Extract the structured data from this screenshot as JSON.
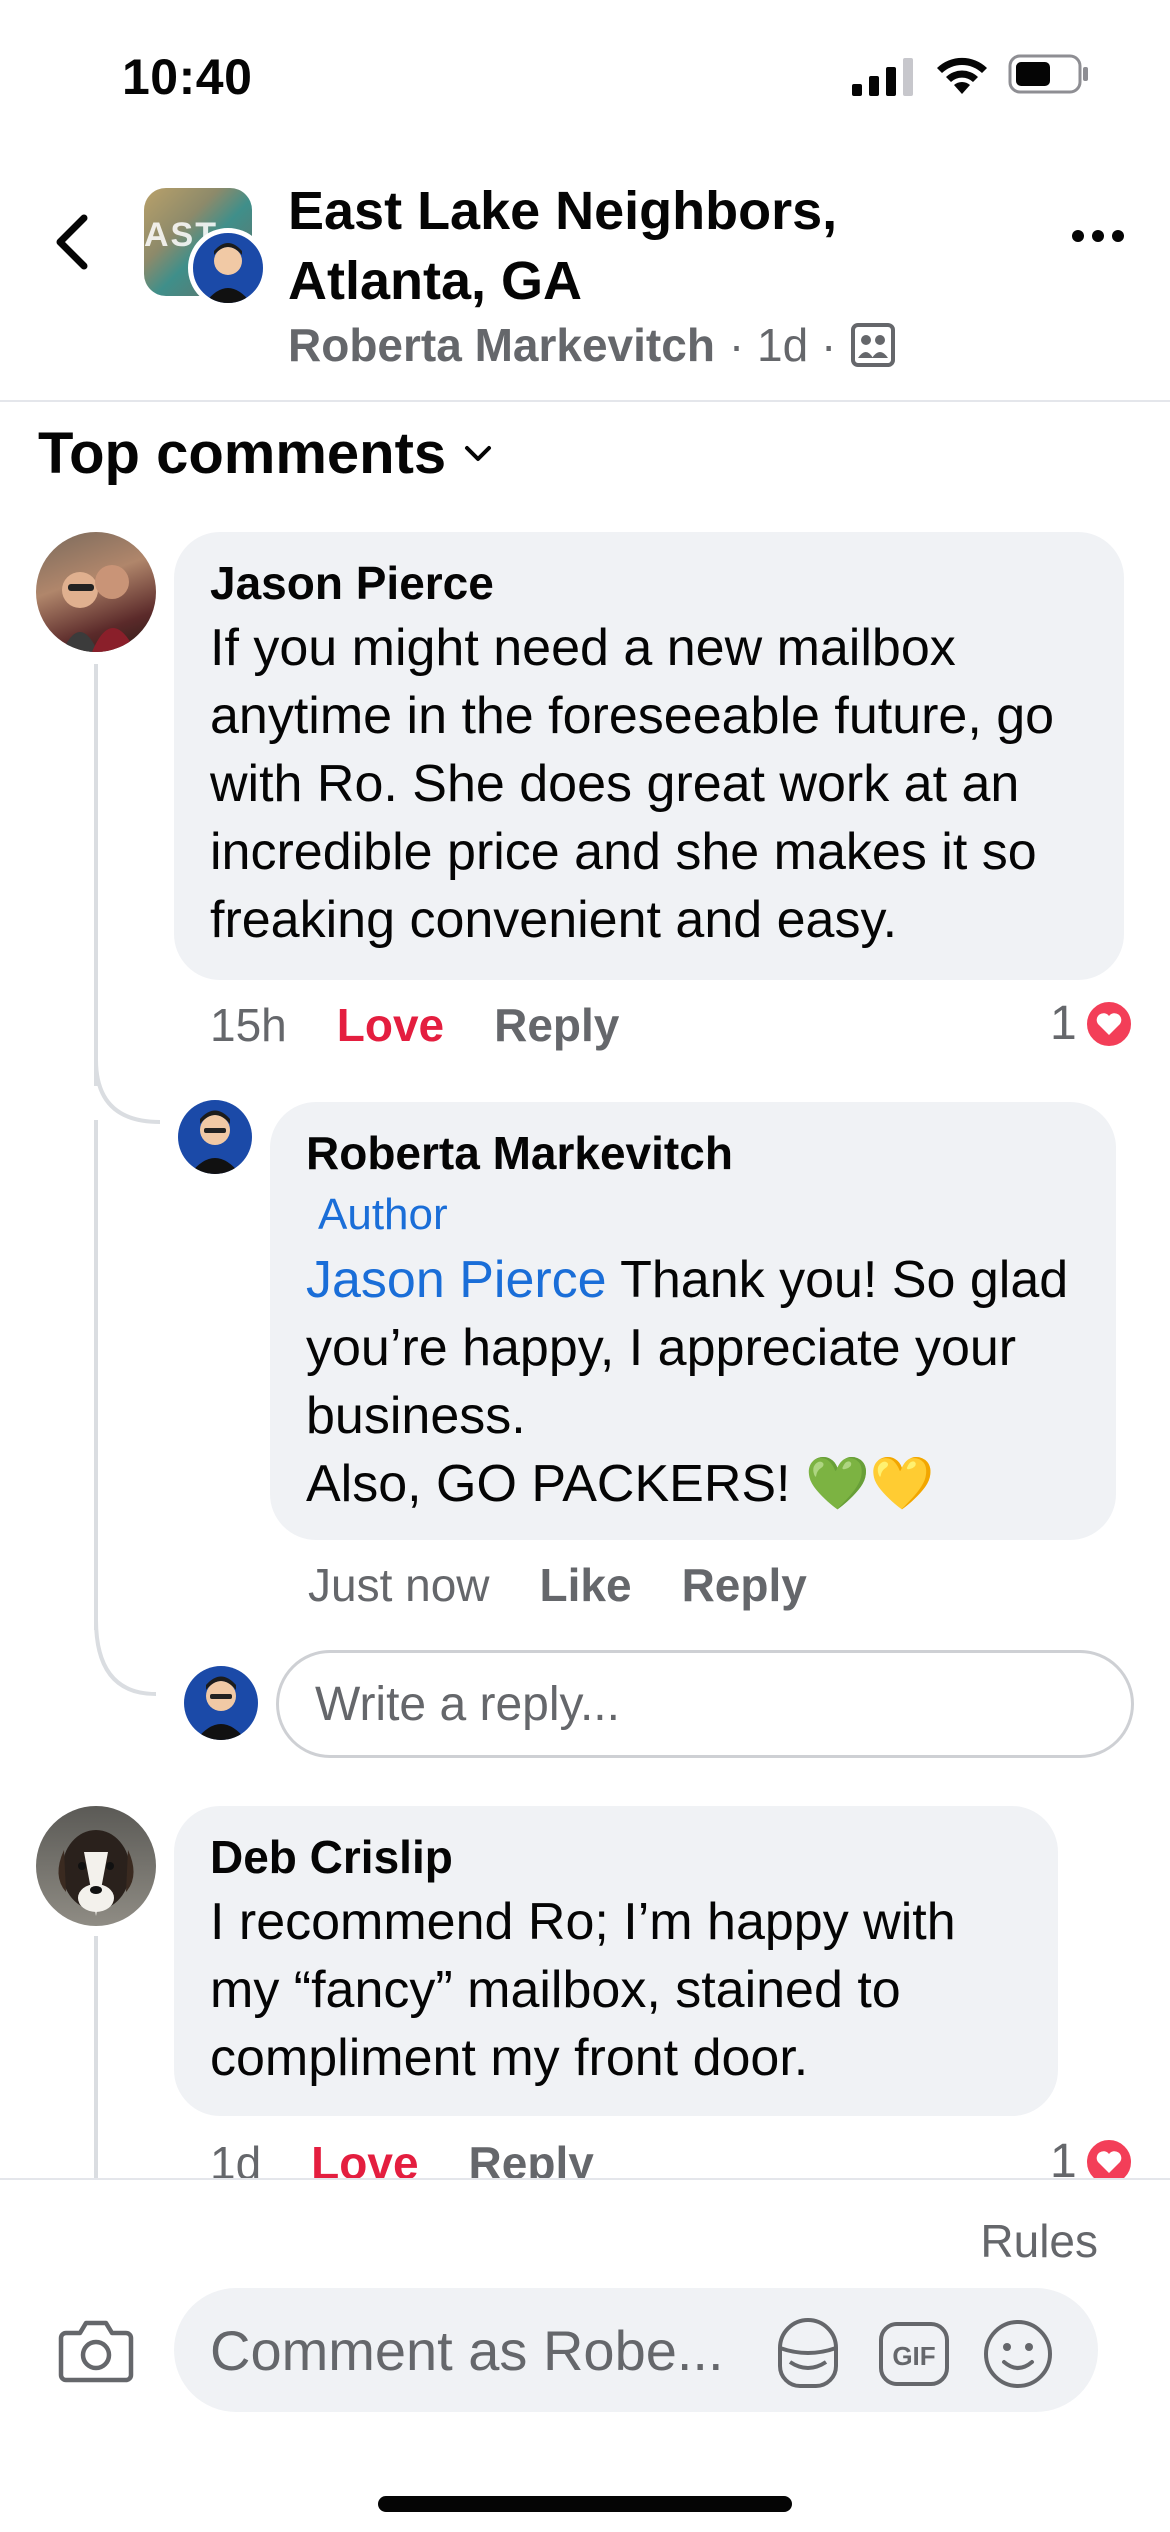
{
  "status_bar": {
    "time": "10:40"
  },
  "header": {
    "group_name": "East Lake Neighbors, Atlanta, GA",
    "author": "Roberta Markevitch",
    "meta": "· 1d ·",
    "group_avatar_text": "AST"
  },
  "section": {
    "title": "Top comments"
  },
  "comments": [
    {
      "author": "Jason Pierce",
      "text": "If you might need a new mailbox anytime in the foreseeable future, go with Ro. She does great work at an incredible price and she makes it so freaking convenient and easy.",
      "time": "15h",
      "react_label": "Love",
      "reply_label": "Reply",
      "reaction_count": "1",
      "reply": {
        "author": "Roberta Markevitch",
        "badge": "Author",
        "mention": "Jason Pierce",
        "text_line1": "Thank you! So glad you’re happy, I appreciate your business.",
        "text_line2": "Also, GO PACKERS! 💚💛",
        "time": "Just now",
        "react_label": "Like",
        "reply_label": "Reply"
      },
      "reply_placeholder": "Write a reply..."
    },
    {
      "author": "Deb Crislip",
      "text": "I recommend Ro; I’m happy with my “fancy” mailbox, stained to compliment my front door.",
      "time": "1d",
      "react_label": "Love",
      "reply_label": "Reply",
      "reaction_count": "1"
    }
  ],
  "composer": {
    "rules_label": "Rules",
    "placeholder": "Comment as Robe...",
    "gif_label": "GIF"
  },
  "colors": {
    "love": "#e41e3f",
    "mention": "#1a6ed8",
    "bubble": "#f0f2f5",
    "secondary_text": "#65676b"
  }
}
